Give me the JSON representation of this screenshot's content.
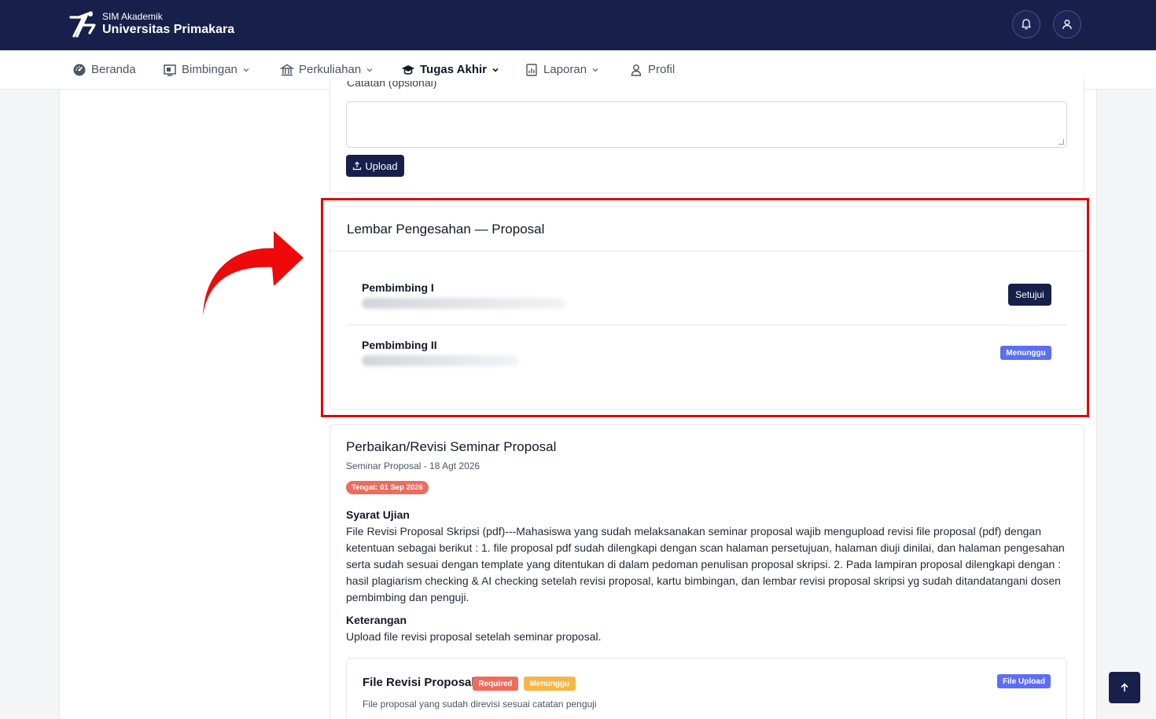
{
  "header": {
    "subtitle": "SIM Akademik",
    "title": "Universitas Primakara",
    "icons": [
      "bell-icon",
      "user-icon"
    ]
  },
  "nav": {
    "items": [
      {
        "label": "Beranda",
        "icon": "dashboard-icon",
        "dropdown": false
      },
      {
        "label": "Bimbingan",
        "icon": "board-icon",
        "dropdown": true
      },
      {
        "label": "Perkuliahan",
        "icon": "building-icon",
        "dropdown": true
      },
      {
        "label": "Tugas Akhir",
        "icon": "graduation-cap-icon",
        "dropdown": true,
        "active": true
      },
      {
        "label": "Laporan",
        "icon": "report-icon",
        "dropdown": true
      },
      {
        "label": "Profil",
        "icon": "user-icon",
        "dropdown": false
      }
    ]
  },
  "upload_form": {
    "note_label": "Catatan (opsional)",
    "textarea_value": "",
    "upload_button": "Upload"
  },
  "approval": {
    "title": "Lembar Pengesahan — Proposal",
    "rows": [
      {
        "label": "Pembimbing I",
        "action": "Setujui"
      },
      {
        "label": "Pembimbing II",
        "status": "Menunggu"
      }
    ]
  },
  "revision": {
    "title": "Perbaikan/Revisi Seminar Proposal",
    "subtitle": "Seminar Proposal - 18 Agt 2026",
    "deadline_badge": "Tengat: 01 Sep 2026",
    "requirement_heading": "Syarat Ujian",
    "requirement_text": "File Revisi Proposal Skripsi (pdf)---Mahasiswa yang sudah melaksanakan seminar proposal wajib mengupload revisi file proposal (pdf) dengan ketentuan sebagai berikut : 1. file proposal pdf sudah dilengkapi dengan scan halaman persetujuan, halaman diuji dinilai, dan halaman pengesahan serta sudah sesuai dengan template yang ditentukan di dalam pedoman penulisan proposal skripsi. 2. Pada lampiran proposal dilengkapi dengan : hasil plagiarism checking & AI checking setelah revisi proposal, kartu bimbingan, dan lembar revisi proposal skripsi yg sudah ditandatangani dosen pembimbing dan penguji.",
    "note_heading": "Keterangan",
    "note_text": "Upload file revisi proposal setelah seminar proposal.",
    "file": {
      "title": "File Revisi Proposal",
      "badge_required": "Required",
      "badge_status": "Menunggu",
      "type_badge": "File Upload",
      "description": "File proposal yang sudah direvisi sesuai catatan penguji"
    }
  },
  "colors": {
    "navy": "#17204a",
    "highlight": "#e10600",
    "badge_blue": "#5b6ef5",
    "badge_red": "#ef6b5b",
    "badge_orange": "#f5b547"
  }
}
